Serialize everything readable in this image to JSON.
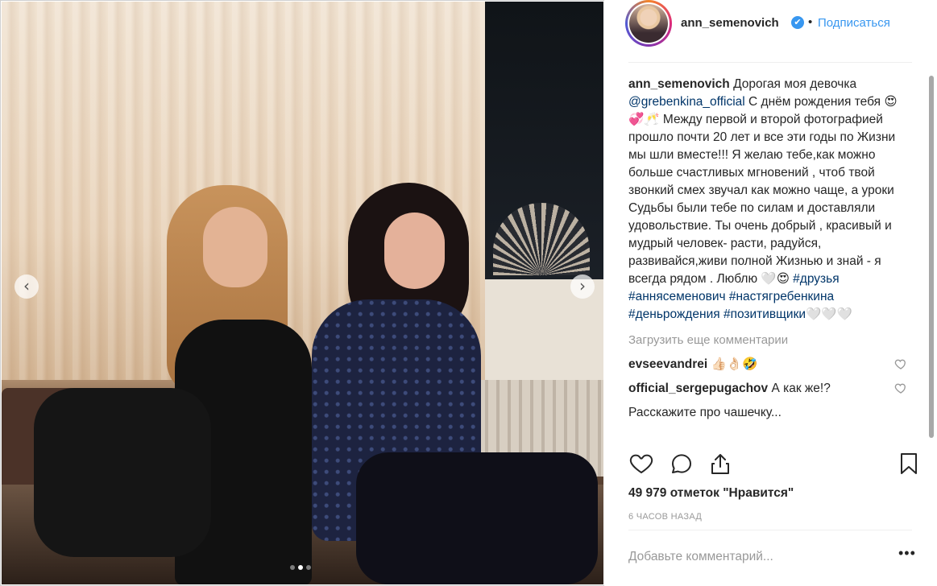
{
  "post": {
    "username": "ann_semenovich",
    "header_separator": "•",
    "follow_label": "Подписаться",
    "verified_mark": "✔",
    "caption": {
      "username": "ann_semenovich",
      "text_1": "Дорогая моя девочка",
      "mention": "@grebenkina_official",
      "text_2": "С днём рождения тебя 😍💞🥂 Между первой и второй фотографией прошло почти 20 лет и все эти годы по Жизни мы шли вместе!!! Я желаю тебе,как можно больше счастливых мгновений , чтоб твой звонкий смех звучал как можно чаще, а уроки Судьбы были тебе по силам и доставляли удовольствие. Ты очень добрый , красивый и мудрый человек- расти, радуйся, развивайся,живи полной Жизнью и знай - я всегда рядом . Люблю 🤍😍",
      "tag_1": "#друзья",
      "tag_2": "#аннясеменович",
      "tag_3": "#настягребенкина",
      "tag_4": "#деньрождения",
      "tag_5": "#позитивщики",
      "tail": "🤍🤍🤍"
    },
    "load_more_label": "Загрузить еще комментарии",
    "comments": [
      {
        "username": "evseevandrei",
        "text": "👍🏻👌🏻🤣"
      },
      {
        "username": "official_sergepugachov",
        "text": "А как же!?"
      },
      {
        "username": "",
        "text": "Расскажите про чашечку..."
      }
    ],
    "likes_text": "49 979 отметок \"Нравится\"",
    "time_text": "6 часов назад",
    "add_comment_placeholder": "Добавьте комментарий...",
    "more_label": "•••"
  },
  "carousel": {
    "prev_label": "‹",
    "next_label": "›",
    "dots": 3,
    "active_index": 1
  },
  "icons": [
    "heart-icon",
    "comment-icon",
    "share-icon",
    "bookmark-icon",
    "verified-icon"
  ],
  "colors": {
    "link": "#003569",
    "accent": "#3897f0",
    "muted": "#999999",
    "text": "#262626"
  }
}
